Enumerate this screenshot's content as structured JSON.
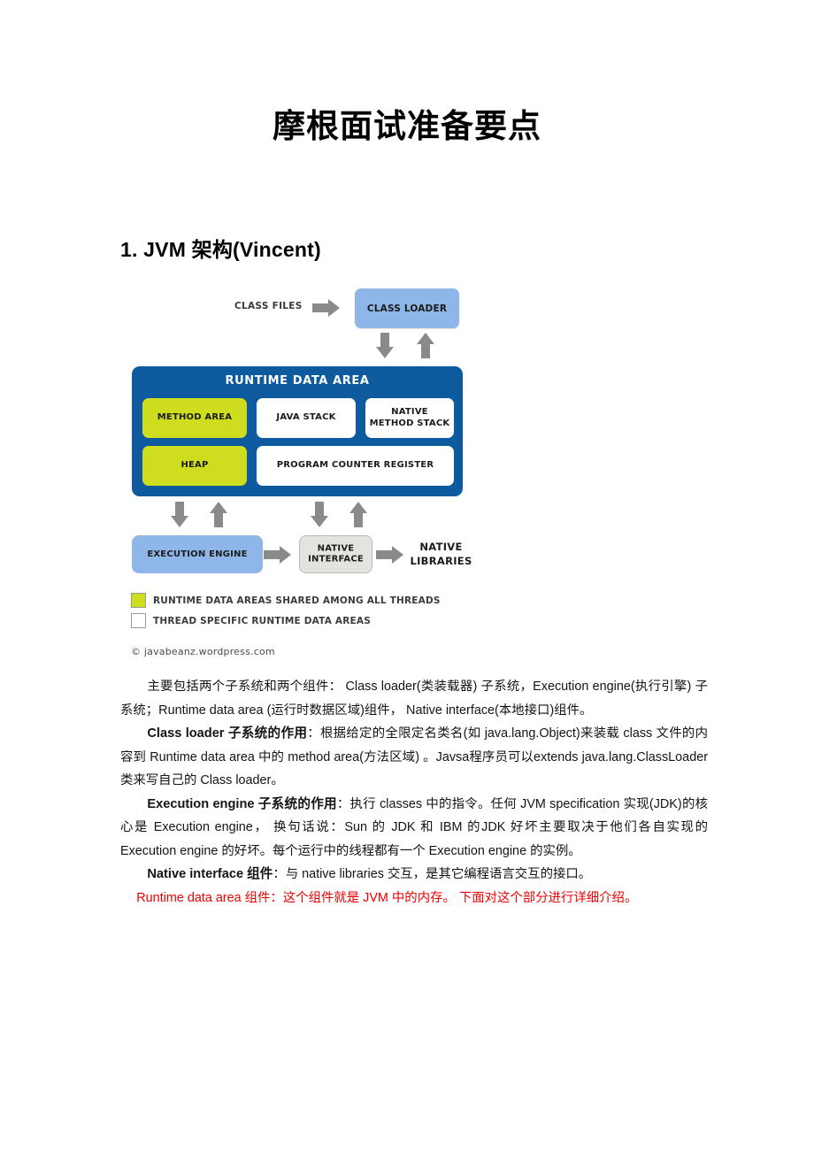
{
  "document": {
    "title": "摩根面试准备要点",
    "section_heading": "1. JVM 架构(Vincent)"
  },
  "diagram": {
    "class_files_label": "CLASS FILES",
    "class_loader_label": "CLASS LOADER",
    "runtime_data_area_title": "RUNTIME DATA AREA",
    "cells": {
      "method_area": "METHOD AREA",
      "java_stack": "JAVA STACK",
      "native_method_stack": "NATIVE METHOD STACK",
      "heap": "HEAP",
      "program_counter_register": "PROGRAM COUNTER REGISTER"
    },
    "execution_engine_label": "EXECUTION ENGINE",
    "native_interface_label": "NATIVE INTERFACE",
    "native_libraries_label": "NATIVE LIBRARIES",
    "legend": [
      {
        "swatch": "green",
        "text": "RUNTIME DATA AREAS SHARED AMONG ALL THREADS"
      },
      {
        "swatch": "white",
        "text": "THREAD SPECIFIC RUNTIME DATA AREAS"
      }
    ],
    "credit": "© javabeanz.wordpress.com",
    "colors": {
      "class_loader_blue": "#8fb6e8",
      "runtime_area_blue": "#0d5a9e",
      "shared_green": "#cfdd1f",
      "arrow_gray": "#8a8a8a",
      "native_interface_gray": "#e3e3e0"
    }
  },
  "paragraphs": {
    "p1": "主要包括两个子系统和两个组件： Class loader(类装载器) 子系统，Execution engine(执行引擎) 子系统；Runtime data area (运行时数据区域)组件， Native interface(本地接口)组件。",
    "p2_bold": "Class loader 子系统的作用",
    "p2_rest": "：根据给定的全限定名类名(如 java.lang.Object)来装载 class 文件的内容到 Runtime data area 中的 method area(方法区域) 。Javsa程序员可以extends java.lang.ClassLoader 类来写自己的 Class loader。",
    "p3_bold": "Execution engine 子系统的作用",
    "p3_rest": "：执行 classes 中的指令。任何 JVM specification 实现(JDK)的核心是 Execution engine， 换句话说：Sun 的 JDK 和 IBM 的JDK 好坏主要取决于他们各自实现的 Execution engine 的好坏。每个运行中的线程都有一个 Execution engine 的实例。",
    "p4_bold": "Native interface 组件",
    "p4_rest": "：与 native libraries 交互，是其它编程语言交互的接口。",
    "p5_red": "Runtime data area 组件：这个组件就是 JVM 中的内存。 下面对这个部分进行详细介绍。",
    "red_color": "#ee0000"
  }
}
